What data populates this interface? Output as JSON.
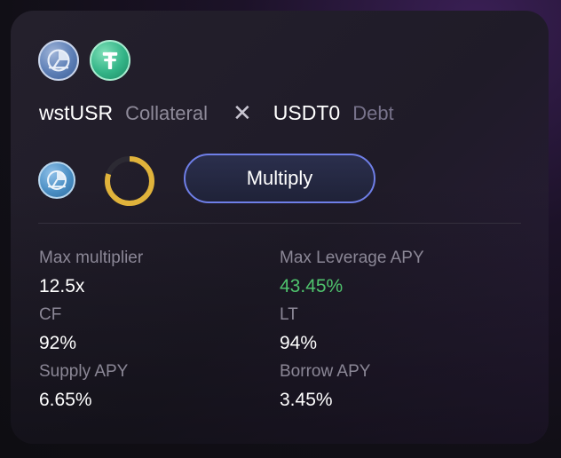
{
  "pair": {
    "collateral_symbol": "wstUSR",
    "collateral_role": "Collateral",
    "separator": "✕",
    "debt_symbol": "USDT0",
    "debt_role": "Debt"
  },
  "icons": {
    "collateral_token": "wstusr-token-icon",
    "debt_token": "usdt0-token-icon",
    "selected_token": "wstusr-token-icon",
    "progress": "loading-ring-icon"
  },
  "progress": {
    "fraction": 0.8,
    "color": "#e0b33b"
  },
  "actions": {
    "multiply_label": "Multiply"
  },
  "stats": {
    "max_multiplier_label": "Max multiplier",
    "max_multiplier_value": "12.5x",
    "max_leverage_apy_label": "Max Leverage APY",
    "max_leverage_apy_value": "43.45%",
    "cf_label": "CF",
    "cf_value": "92%",
    "lt_label": "LT",
    "lt_value": "94%",
    "supply_apy_label": "Supply APY",
    "supply_apy_value": "6.65%",
    "borrow_apy_label": "Borrow APY",
    "borrow_apy_value": "3.45%"
  },
  "colors": {
    "accent_button_border": "#6f7fe8",
    "positive_green": "#4fc36d"
  }
}
